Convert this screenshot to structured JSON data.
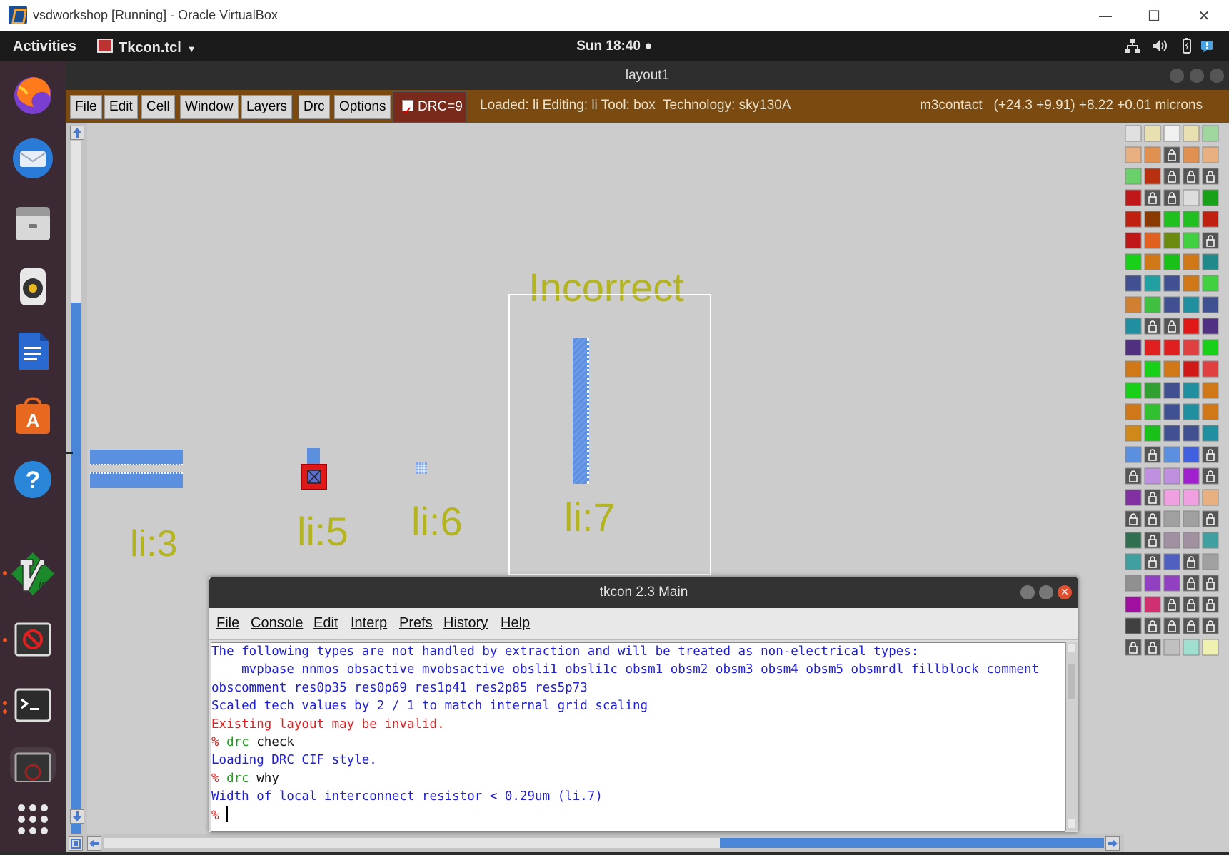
{
  "host_window": {
    "title": "vsdworkshop [Running] - Oracle VirtualBox",
    "controls": [
      "—",
      "☐",
      "✕"
    ]
  },
  "topbar": {
    "activities": "Activities",
    "app_menu": "Tkcon.tcl",
    "clock": "Sun 18:40 ●"
  },
  "dock": {
    "items": [
      "firefox-icon",
      "thunderbird-icon",
      "files-icon",
      "rhythmbox-icon",
      "libreoffice-writer-icon",
      "software-icon",
      "help-icon",
      "vim-icon",
      "blocked-app-icon",
      "terminal-icon",
      "minimized-app-icon",
      "app-grid-icon"
    ]
  },
  "magic": {
    "title": "layout1",
    "menu": [
      "File",
      "Edit",
      "Cell",
      "Window",
      "Layers",
      "Drc",
      "Options"
    ],
    "drc_label": "DRC=9",
    "status": "Loaded: li Editing: li Tool: box  Technology: sky130A",
    "coords": "m3contact   (+24.3 +9.91) +8.22 +0.01 microns",
    "canvas_labels": {
      "li3": "li:3",
      "li5": "li:5",
      "li6": "li:6",
      "li7": "li:7",
      "incorrect": "Incorrect"
    }
  },
  "tkcon": {
    "title": "tkcon 2.3 Main",
    "menu": [
      "File",
      "Console",
      "Edit",
      "Interp",
      "Prefs",
      "History",
      "Help"
    ],
    "lines": {
      "l1": "The following types are not handled by extraction and will be treated as non-electrical types:",
      "l2": "    mvpbase nnmos obsactive mvobsactive obsli1 obsli1c obsm1 obsm2 obsm3 obsm4 obsm5 obsmrdl fillblock comment",
      "l3": "obscomment res0p35 res0p69 res1p41 res2p85 res5p73",
      "l4": "Scaled tech values by 2 / 1 to match internal grid scaling",
      "l5": "Existing layout may be invalid.",
      "prompt": "%",
      "cmd1_kw": "drc",
      "cmd1_arg": "check",
      "l7": "Loading DRC CIF style.",
      "cmd2_kw": "drc",
      "cmd2_arg": "why",
      "l9": "Width of local interconnect resistor < 0.29um (li.7)"
    }
  }
}
